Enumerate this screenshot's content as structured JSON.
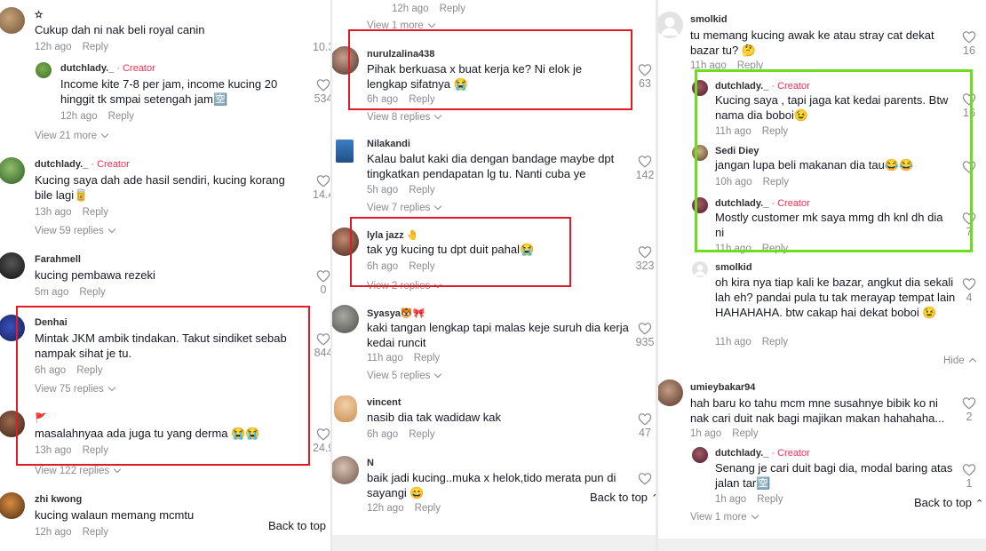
{
  "reply_label": "Reply",
  "creator_label": "· Creator",
  "back_to_top": "Back to top",
  "hide_label": "Hide",
  "colors": {
    "highlight_red": "#e01b24",
    "highlight_green": "#6fdc1f",
    "creator": "#fe2c55"
  },
  "panel1": {
    "comments": [
      {
        "user": "✫",
        "text": "Cukup dah ni nak beli royal canin",
        "time": "12h ago",
        "likes": "10.3"
      },
      {
        "user": "dutchlady._",
        "creator": true,
        "text": "Income kite 7-8 per jam, income kucing 20 hinggit tk smpai setengah jam🈳",
        "time": "12h ago",
        "likes": "534"
      },
      {
        "user": "dutchlady._",
        "creator": true,
        "text": "Kucing saya dah ade hasil sendiri, kucing korang bile lagi🥫",
        "time": "13h ago",
        "likes": "14.4"
      },
      {
        "user": "Farahmell",
        "text": "kucing pembawa rezeki",
        "time": "5m ago",
        "likes": "0"
      },
      {
        "user": "Denhai",
        "text": "Mintak JKM ambik tindakan. Takut sindiket sebab nampak sihat je tu.",
        "time": "6h ago",
        "likes": "844"
      },
      {
        "user": "🚩",
        "text": "masalahnyaa ada juga tu yang derma 😭😭",
        "time": "13h ago",
        "likes": "24.9"
      },
      {
        "user": "zhi kwong",
        "text": "kucing walaun memang mcmtu",
        "time": "12h ago",
        "likes": ""
      }
    ],
    "view_more": [
      "View 21 more",
      "View 59 replies",
      "View 75 replies",
      "View 122 replies"
    ]
  },
  "panel2": {
    "top_meta": {
      "time": "12h ago"
    },
    "top_view": "View 1 more",
    "comments": [
      {
        "user": "nurulzalina438",
        "text": "Pihak berkuasa x buat kerja ke? Ni elok je lengkap sifatnya 😭",
        "time": "6h ago",
        "likes": "63"
      },
      {
        "user": "Nilakandi",
        "text": "Kalau balut kaki dia dengan bandage maybe dpt tingkatkan pendapatan lg tu. Nanti cuba ye",
        "time": "5h ago",
        "likes": "142"
      },
      {
        "user": "lyla jazz 🤚",
        "text": "tak yg kucing tu dpt duit pahal😭",
        "time": "6h ago",
        "likes": "323"
      },
      {
        "user": "Syasya🐯🎀",
        "text": "kaki tangan lengkap tapi malas keje suruh dia kerja kedai runcit",
        "time": "11h ago",
        "likes": "935"
      },
      {
        "user": "vincent",
        "text": "nasib dia tak wadidaw kak",
        "time": "6h ago",
        "likes": "47"
      },
      {
        "user": "N",
        "text": "baik jadi kucing..muka x helok,tido merata pun di sayangi 😄",
        "time": "12h ago",
        "likes": ""
      }
    ],
    "view_more": [
      "View 8 replies",
      "View 7 replies",
      "View 2 replies",
      "View 5 replies"
    ]
  },
  "panel3": {
    "comments": [
      {
        "user": "smolkid",
        "text": "tu memang kucing awak ke atau stray cat dekat bazar tu? 🤔",
        "time": "11h ago",
        "likes": "16"
      },
      {
        "user": "dutchlady._",
        "creator": true,
        "text": "Kucing saya , tapi jaga kat kedai parents. Btw nama dia boboi😉",
        "time": "11h ago",
        "likes": "16"
      },
      {
        "user": "Sedi Diey",
        "text": "jangan lupa beli makanan dia tau😂😂",
        "time": "10h ago",
        "likes": ""
      },
      {
        "user": "dutchlady._",
        "creator": true,
        "text": "Mostly customer mk saya mmg dh knl dh dia ni",
        "time": "11h ago",
        "likes": "7"
      },
      {
        "user": "smolkid",
        "text": "oh kira nya tiap kali ke bazar, angkut dia sekali lah eh? pandai pula tu tak merayap tempat lain HAHAHAHA. btw cakap hai dekat boboi 😉",
        "time": "11h ago",
        "likes": "4"
      },
      {
        "user": "umieybakar94",
        "text": "hah baru ko tahu mcm mne susahnye bibik ko ni nak cari duit nak bagi majikan makan hahahaha...",
        "time": "1h ago",
        "likes": "2"
      },
      {
        "user": "dutchlady._",
        "creator": true,
        "text": "Senang je cari duit bagi dia, modal baring atas jalan tar🈳",
        "time": "1h ago",
        "likes": "1"
      }
    ],
    "view_more": [
      "View 1 more"
    ]
  }
}
